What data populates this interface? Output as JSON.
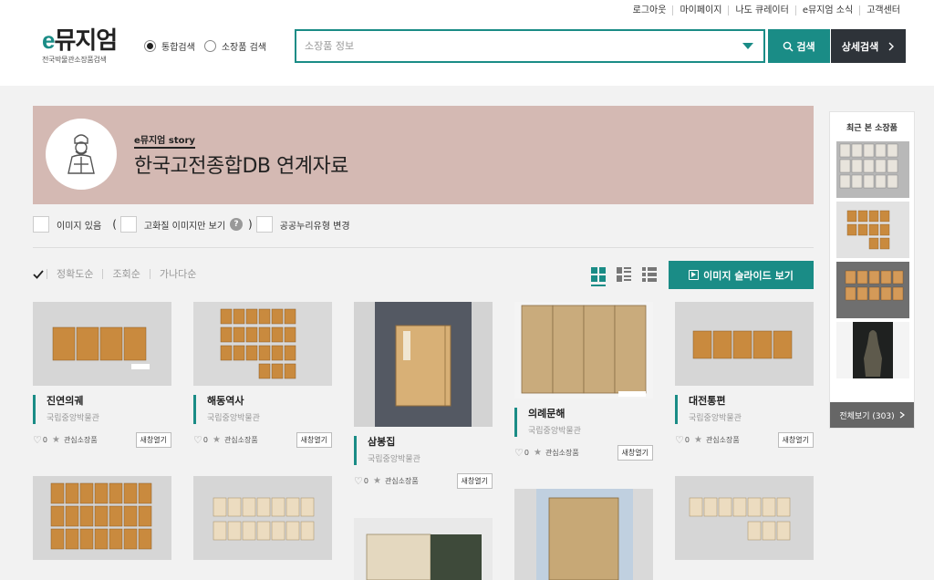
{
  "header": {
    "util_links": [
      "로그아웃",
      "마이페이지",
      "나도 큐레이터",
      "e뮤지엄 소식",
      "고객센터"
    ],
    "logo_e": "e",
    "logo_rest": "뮤지엄",
    "logo_sub": "전국박물관소장품검색",
    "radio_integrated": "통합검색",
    "radio_collection": "소장품 검색",
    "search_placeholder": "소장품 정보",
    "search_button": "검색",
    "detail_search_button": "상세검색"
  },
  "banner": {
    "kicker": "e뮤지엄 story",
    "title": "한국고전종합DB 연계자료"
  },
  "filters": {
    "has_image": "이미지 있음",
    "open_paren": "(",
    "hires_only": "고화질 이미지만 보기",
    "help": "?",
    "close_paren": ")",
    "license_change": "공공누리유형 변경"
  },
  "sort": {
    "options": [
      "정확도순",
      "조회순",
      "가나다순"
    ],
    "active": "정확도순"
  },
  "slide_button": "이미지 슬라이드 보기",
  "items": [
    {
      "name": "진연의궤",
      "museum": "국립중앙박물관",
      "likes": "0",
      "fav_label": "관심소장품",
      "new_window": "새창열기"
    },
    {
      "name": "해동역사",
      "museum": "국립중앙박물관",
      "likes": "0",
      "fav_label": "관심소장품",
      "new_window": "새창열기"
    },
    {
      "name": "삼봉집",
      "museum": "국립중앙박물관",
      "likes": "0",
      "fav_label": "관심소장품",
      "new_window": "새창열기"
    },
    {
      "name": "의례문해",
      "museum": "국립중앙박물관",
      "likes": "0",
      "fav_label": "관심소장품",
      "new_window": "새창열기"
    },
    {
      "name": "대전통편",
      "museum": "국립중앙박물관",
      "likes": "0",
      "fav_label": "관심소장품",
      "new_window": "새창열기"
    }
  ],
  "sidebar": {
    "title": "최근 본 소장품",
    "view_all": "전체보기 (303)"
  },
  "colors": {
    "accent": "#1a8c86",
    "banner_bg": "#d4b9b3",
    "dark_button": "#2e3339"
  }
}
